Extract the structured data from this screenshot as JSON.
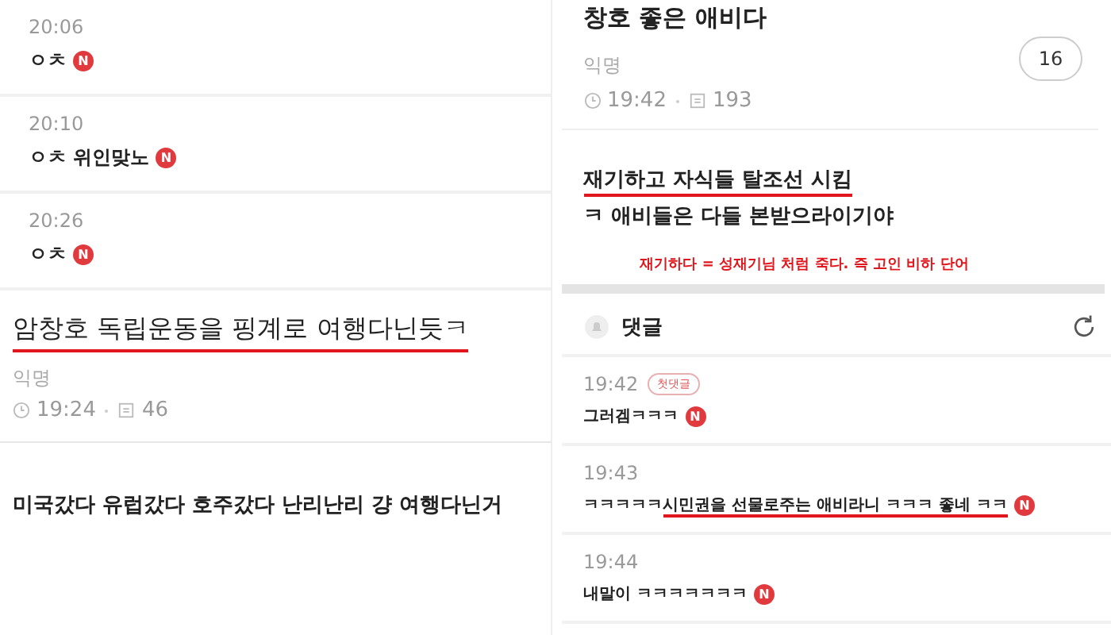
{
  "left_panel": {
    "comments": [
      {
        "time": "20:06",
        "text": "ㅇㅊ",
        "new_mark": "N"
      },
      {
        "time": "20:10",
        "text": "ㅇㅊ 위인맞노",
        "new_mark": "N"
      },
      {
        "time": "20:26",
        "text": "ㅇㅊ",
        "new_mark": "N"
      }
    ],
    "post": {
      "title": "암창호 독립운동을 핑계로 여행다닌듯ㅋ",
      "title_underlined": true,
      "author": "익명",
      "time": "19:24",
      "views": "46"
    },
    "body": "미국갔다 유럽갔다 호주갔다 난리난리 걍 여행다닌거"
  },
  "right_panel": {
    "post": {
      "title": "창호 좋은 애비다",
      "author": "익명",
      "time": "19:42",
      "views": "193",
      "comment_count": "16"
    },
    "body_lines": [
      {
        "text": "재기하고 자식들 탈조선 시킴",
        "underlined": true
      },
      {
        "text": "ㅋ 애비들은 다들 본받으라이기야",
        "underlined": false
      }
    ],
    "annotation": "재기하다 = 성재기님 처럼 죽다. 즉 고인 비하 단어",
    "comments_header": "댓글",
    "comments": [
      {
        "time": "19:42",
        "badge": "첫댓글",
        "segments": [
          {
            "text": "그러겜ㅋㅋㅋ",
            "underlined": false
          }
        ],
        "new_mark": "N"
      },
      {
        "time": "19:43",
        "segments": [
          {
            "text": "ㅋㅋㅋㅋㅋ",
            "underlined": false
          },
          {
            "text": "시민권을 선물로주는 애비라니 ㅋㅋㅋ 좋네 ㅋㅋ",
            "underlined": true
          }
        ],
        "new_mark": "N"
      },
      {
        "time": "19:44",
        "segments": [
          {
            "text": "내말이 ㅋㅋㅋㅋㅋㅋㅋ",
            "underlined": false
          }
        ],
        "new_mark": "N"
      }
    ]
  }
}
